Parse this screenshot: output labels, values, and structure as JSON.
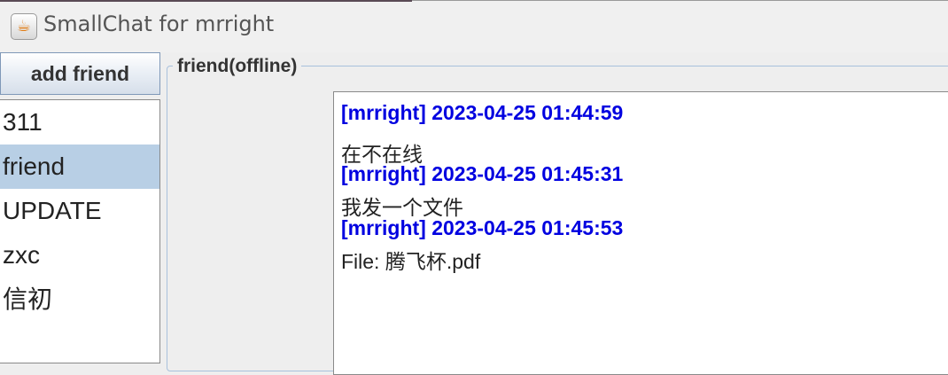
{
  "window": {
    "title": "SmallChat for mrright",
    "icon": "java-cup-icon"
  },
  "sidebar": {
    "add_button_label": "add friend",
    "friends": [
      {
        "name": "311",
        "selected": false
      },
      {
        "name": "friend",
        "selected": true
      },
      {
        "name": "UPDATE",
        "selected": false
      },
      {
        "name": "zxc",
        "selected": false
      },
      {
        "name": "信初",
        "selected": false
      }
    ]
  },
  "chat": {
    "panel_title": "friend(offline)",
    "header_color": "#0000e0",
    "messages": [
      {
        "header": "[mrright] 2023-04-25 01:44:59",
        "body": "在不在线"
      },
      {
        "header": "[mrright] 2023-04-25 01:45:31",
        "body": "我发一个文件"
      },
      {
        "header": "[mrright] 2023-04-25 01:45:53",
        "body": "File: 腾飞杯.pdf"
      }
    ]
  }
}
